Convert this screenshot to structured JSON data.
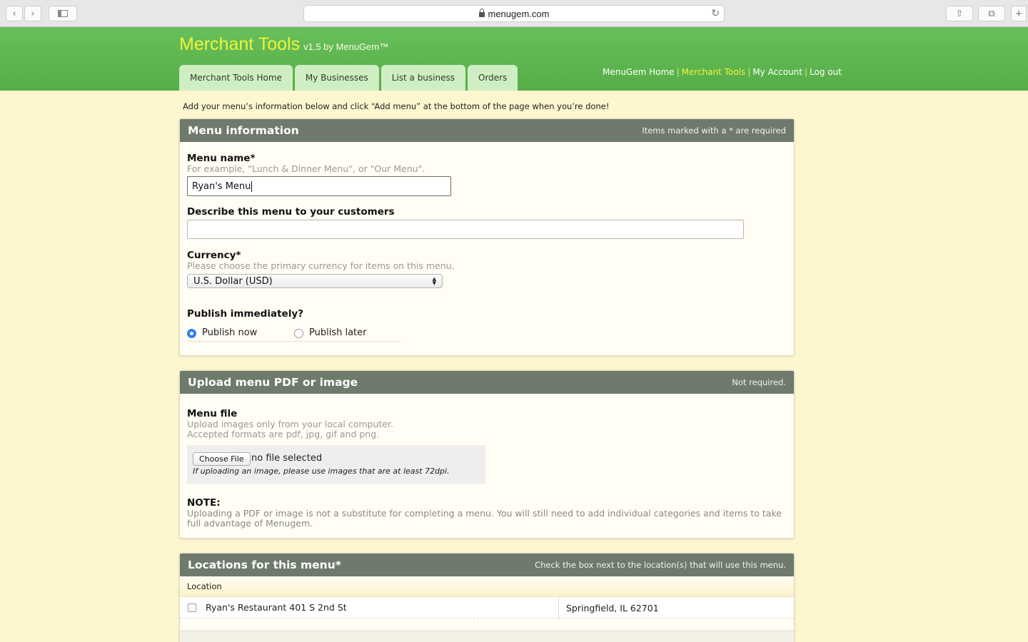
{
  "browser": {
    "url": "menugem.com"
  },
  "header": {
    "brand": "Merchant Tools",
    "version": "v1.5 by MenuGem™",
    "tabs": [
      "Merchant Tools Home",
      "My Businesses",
      "List a business",
      "Orders"
    ],
    "topnav": [
      "MenuGem Home",
      "Merchant Tools",
      "My Account",
      "Log out"
    ],
    "separator": "|"
  },
  "intro": "Add your menu’s information below and click “Add menu” at the bottom of the page when you’re done!",
  "menu_info": {
    "title": "Menu information",
    "note": "Items marked with a * are required",
    "name_label": "Menu name*",
    "name_hint": "For example, \"Lunch & Dinner Menu\", or \"Our Menu\".",
    "name_value": "Ryan's Menu",
    "describe_label": "Describe this menu to your customers",
    "describe_value": "",
    "currency_label": "Currency*",
    "currency_hint": "Please choose the primary currency for items on this menu.",
    "currency_value": "U.S. Dollar (USD)",
    "publish_label": "Publish immediately?",
    "publish_now": "Publish now",
    "publish_later": "Publish later",
    "publish_selected": "Publish now"
  },
  "upload": {
    "title": "Upload menu PDF or image",
    "note": "Not required.",
    "file_label": "Menu file",
    "hint1": "Upload images only from your local computer.",
    "hint2": "Accepted formats are pdf, jpg, gif and png.",
    "choose_button": "Choose File",
    "file_status": "no file selected",
    "dpi_hint": "If uploading an image, please use images that are at least 72dpi.",
    "note_label": "NOTE:",
    "note_text": "Uploading a PDF or image is not a substitute for completing a menu. You will still need to add individual categories and items to take full advantage of Menugem."
  },
  "locations": {
    "title": "Locations for this menu*",
    "note": "Check the box next to the location(s) that will use this menu.",
    "column": "Location",
    "rows": [
      {
        "name": "Ryan's Restaurant 401 S 2nd St",
        "city": "Springfield, IL 62701",
        "checked": false
      }
    ]
  }
}
